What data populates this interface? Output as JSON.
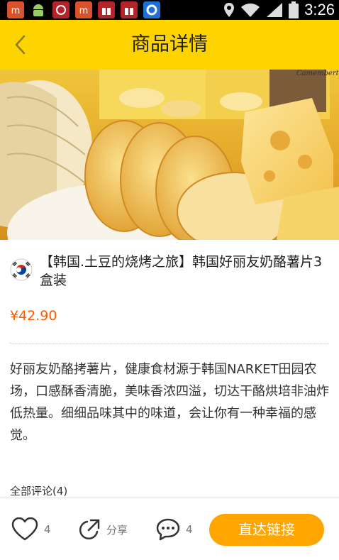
{
  "status_bar": {
    "time": "3:26",
    "icons": [
      "app-red-a-icon",
      "android-icon",
      "app-red-b-icon",
      "app-red-c-icon",
      "app-gift-a-icon",
      "app-gift-b-icon",
      "app-blue-icon",
      "location-icon",
      "wifi-icon",
      "signal-icon",
      "battery-icon"
    ]
  },
  "header": {
    "title": "商品详情",
    "back_icon": "chevron-left-icon",
    "background": "#fdd400"
  },
  "hero": {
    "image": "potato-chips-cheese-photo",
    "brand_text": "Camembert"
  },
  "product": {
    "flag_icon": "korea-flag-icon",
    "title": "【韩国.土豆的烧烤之旅】韩国好丽友奶酪薯片3盒装",
    "price": "¥42.90",
    "price_color": "#ff5a00",
    "description": "好丽友奶酪拷薯片，健康食材源于韩国NARKET田园农场，口感酥香清脆，美味香浓四溢，切达干酪烘培非油炸低热量。细细品味其中的味道，会让你有一种幸福的感觉。"
  },
  "comments": {
    "label": "全部评论(4)"
  },
  "bottom_bar": {
    "like_count": "4",
    "share_label": "分享",
    "comment_count": "4",
    "goto_label": "直达链接",
    "accent": "#ffa500"
  }
}
